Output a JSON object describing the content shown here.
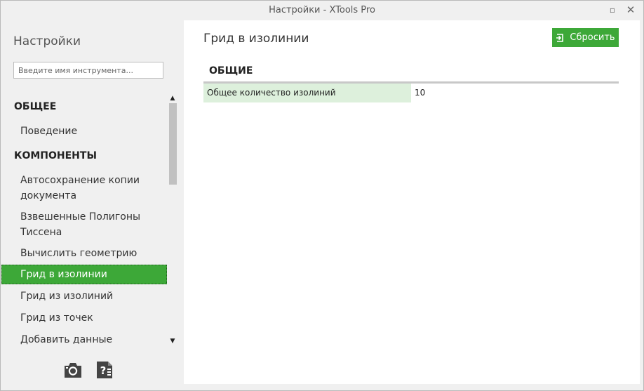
{
  "window": {
    "title": "Настройки - XTools Pro",
    "maximize_glyph": "▫",
    "close_glyph": "✕"
  },
  "sidebar": {
    "title": "Настройки",
    "search_placeholder": "Введите имя инструмента...",
    "items": [
      {
        "label": "ОБЩЕЕ",
        "kind": "header"
      },
      {
        "label": "Поведение",
        "kind": "item"
      },
      {
        "label": "КОМПОНЕНТЫ",
        "kind": "header"
      },
      {
        "label": "Автосохранение копии документа",
        "kind": "item"
      },
      {
        "label": "Взвешенные Полигоны Тиссена",
        "kind": "item"
      },
      {
        "label": "Вычислить геометрию",
        "kind": "item"
      },
      {
        "label": "Грид в изолинии",
        "kind": "item",
        "selected": true
      },
      {
        "label": "Грид из изолиний",
        "kind": "item"
      },
      {
        "label": "Грид из точек",
        "kind": "item"
      },
      {
        "label": "Добавить данные",
        "kind": "item"
      }
    ],
    "scroll_up_glyph": "▲",
    "scroll_down_glyph": "▼",
    "icons": [
      "camera-icon",
      "help-document-icon"
    ]
  },
  "main": {
    "title": "Грид в изолинии",
    "reset_label": "Сбросить",
    "reset_icon": "reset-icon",
    "section_title": "ОБЩИЕ",
    "properties": [
      {
        "name": "Общее количество изолиний",
        "value": "10"
      }
    ]
  },
  "colors": {
    "accent": "#3da838",
    "selected_row": "#ddf0dc",
    "window_bg": "#f0f0f0"
  }
}
